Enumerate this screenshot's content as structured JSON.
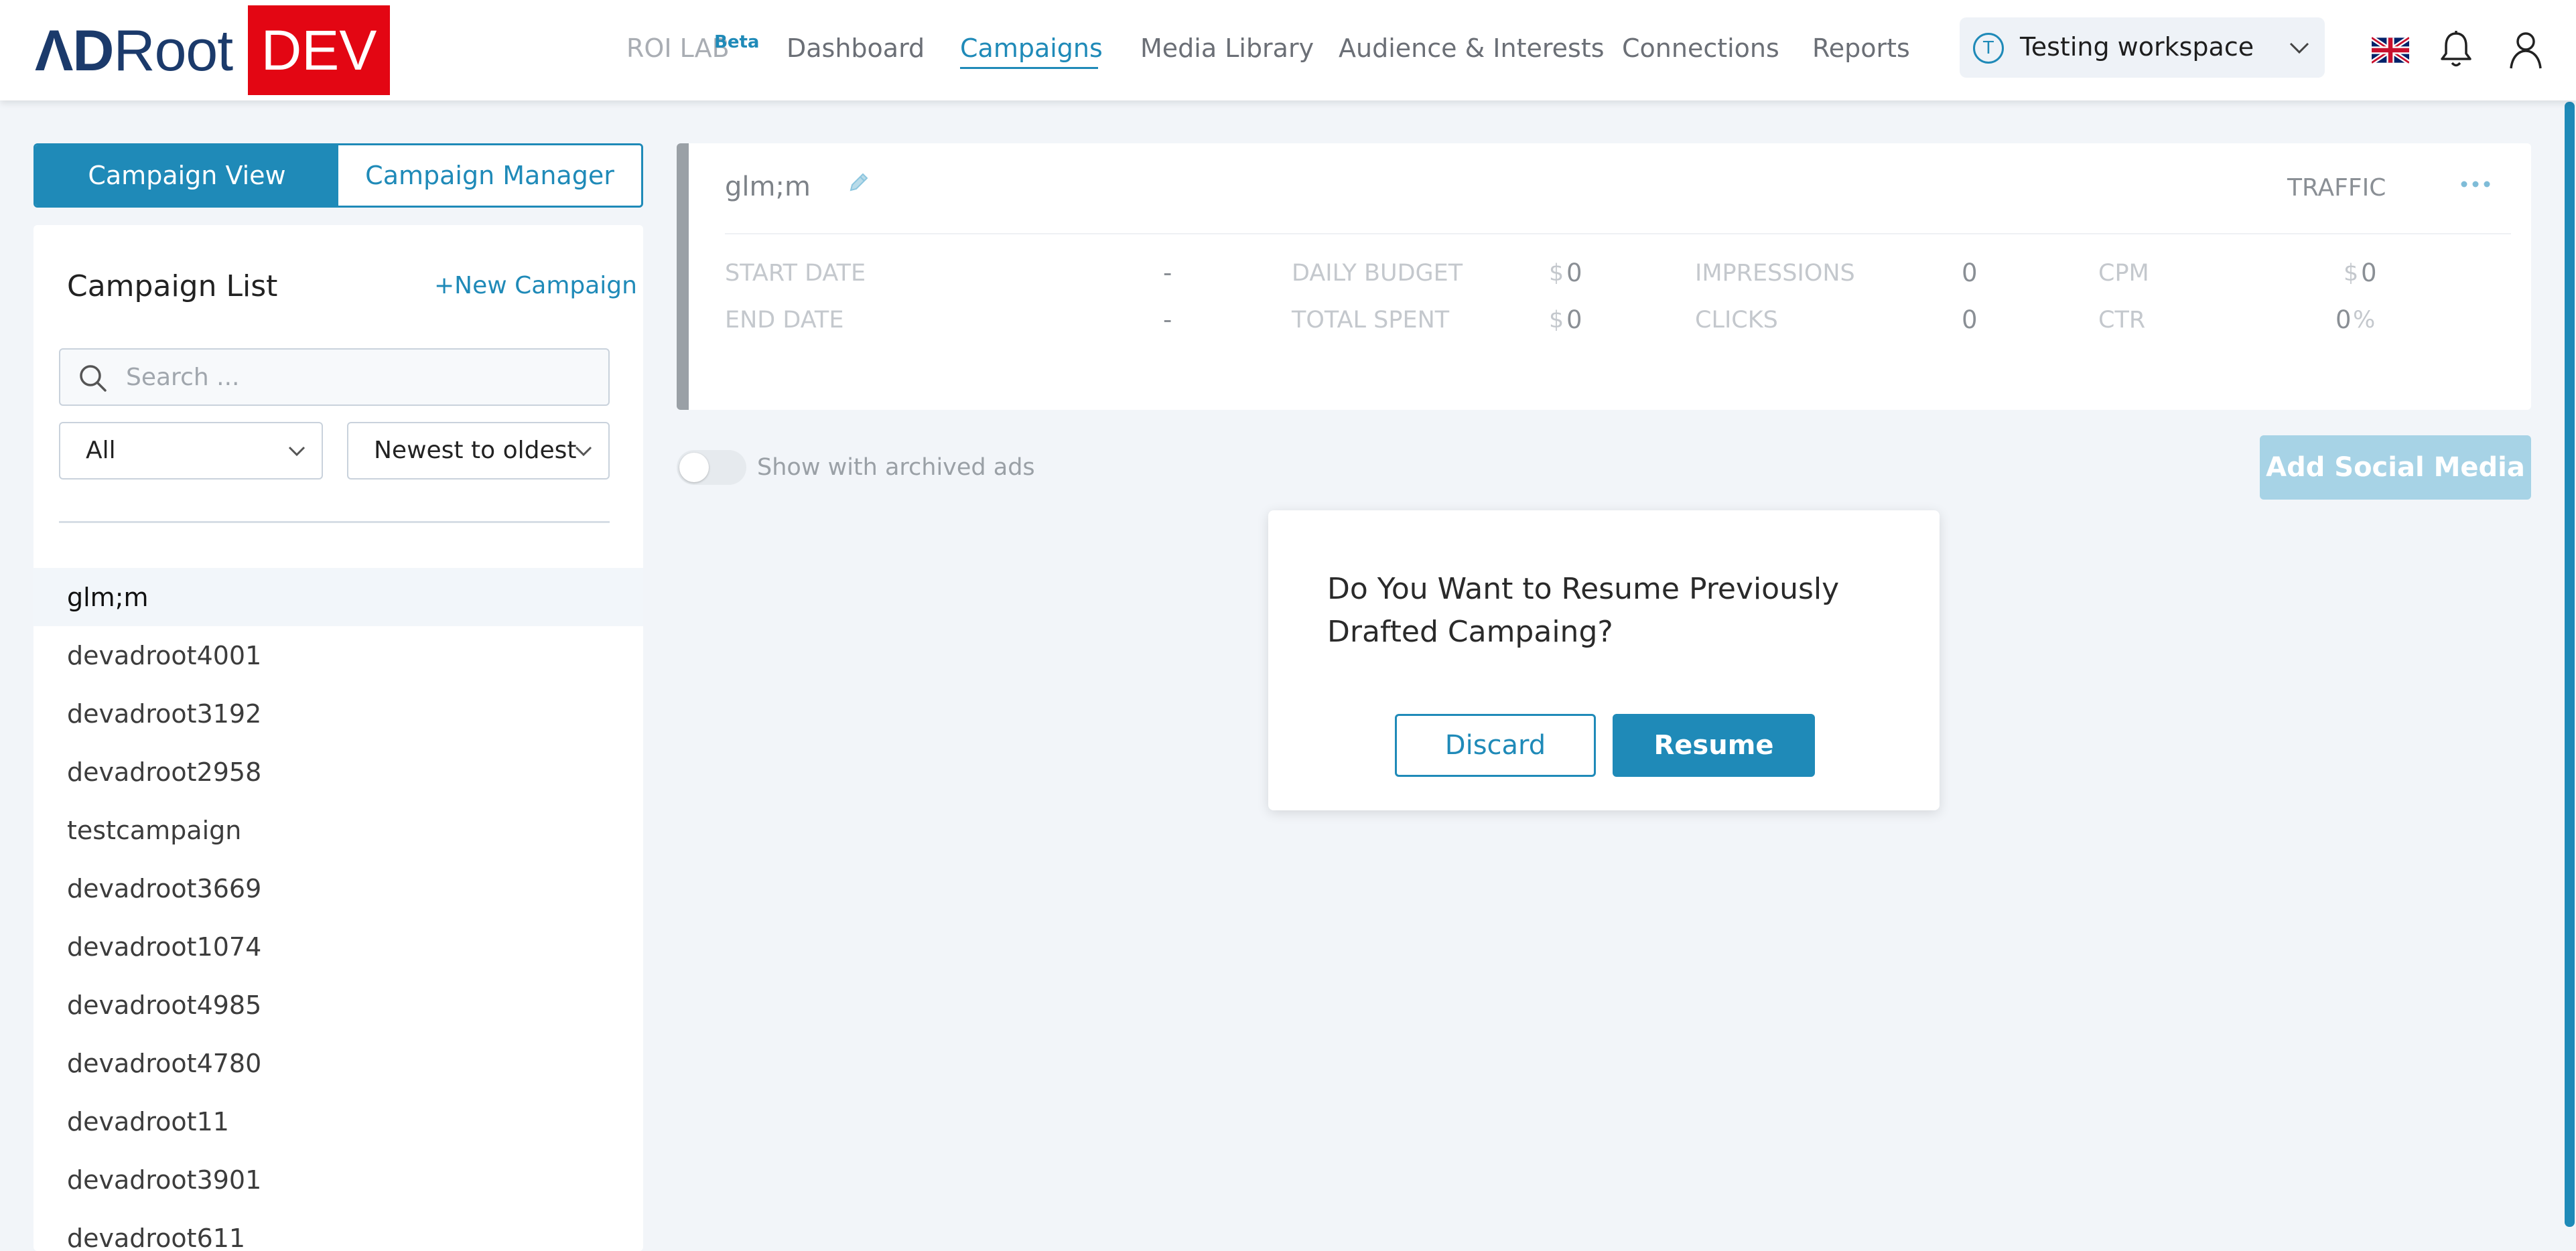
{
  "header": {
    "logo_part1": "ΛD",
    "logo_part2": "Root",
    "env_badge": "DEV",
    "nav": {
      "roi_lab": "ROI LAB",
      "roi_lab_badge": "Beta",
      "items": [
        {
          "label": "Dashboard",
          "active": false
        },
        {
          "label": "Campaigns",
          "active": true
        },
        {
          "label": "Media Library",
          "active": false
        },
        {
          "label": "Audience & Interests",
          "active": false
        },
        {
          "label": "Connections",
          "active": false
        },
        {
          "label": "Reports",
          "active": false
        }
      ]
    },
    "workspace": {
      "initial": "T",
      "label": "Testing workspace"
    },
    "icons": [
      "uk-flag-icon",
      "bell-icon",
      "user-icon"
    ]
  },
  "view_toggle": {
    "campaign_view": "Campaign View",
    "campaign_manager": "Campaign Manager",
    "active": "campaign_view"
  },
  "sidebar": {
    "title": "Campaign List",
    "new_campaign": "+New Campaign",
    "search_placeholder": "Search ...",
    "filter_value": "All",
    "sort_value": "Newest to oldest",
    "campaigns": [
      "glm;m",
      "devadroot4001",
      "devadroot3192",
      "devadroot2958",
      "testcampaign",
      "devadroot3669",
      "devadroot1074",
      "devadroot4985",
      "devadroot4780",
      "devadroot11",
      "devadroot3901",
      "devadroot611"
    ],
    "selected_index": 0
  },
  "campaign_card": {
    "name": "glm;m",
    "objective": "TRAFFIC",
    "stats": {
      "start_date_label": "START DATE",
      "start_date_value": "-",
      "end_date_label": "END DATE",
      "end_date_value": "-",
      "daily_budget_label": "DAILY BUDGET",
      "daily_budget_currency": "$",
      "daily_budget_value": "0",
      "total_spent_label": "TOTAL SPENT",
      "total_spent_currency": "$",
      "total_spent_value": "0",
      "impressions_label": "IMPRESSIONS",
      "impressions_value": "0",
      "clicks_label": "CLICKS",
      "clicks_value": "0",
      "cpm_label": "CPM",
      "cpm_currency": "$",
      "cpm_value": "0",
      "ctr_label": "CTR",
      "ctr_value": "0",
      "ctr_unit": "%"
    }
  },
  "archived_toggle": {
    "label": "Show with archived ads",
    "on": false
  },
  "add_social_media": "Add Social Media",
  "modal": {
    "message": "Do You Want to Resume Previously Drafted Campaing?",
    "discard": "Discard",
    "resume": "Resume"
  },
  "colors": {
    "accent": "#1f8ab8",
    "dev_badge": "#e30613",
    "logo": "#1b3a6b",
    "background": "#f2f5f9"
  }
}
